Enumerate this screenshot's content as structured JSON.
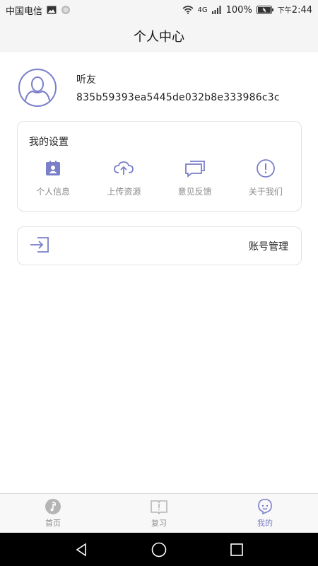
{
  "status_bar": {
    "carrier": "中国电信",
    "battery_percent": "100%",
    "time_prefix": "下午",
    "time": "2:44",
    "network": "4G"
  },
  "header": {
    "title": "个人中心"
  },
  "profile": {
    "name": "听友",
    "id": "835b59393ea5445de032b8e333986c3c"
  },
  "settings": {
    "title": "我的设置",
    "items": [
      {
        "label": "个人信息",
        "icon": "id-card-icon"
      },
      {
        "label": "上传资源",
        "icon": "cloud-upload-icon"
      },
      {
        "label": "意见反馈",
        "icon": "chat-bubbles-icon"
      },
      {
        "label": "关于我们",
        "icon": "info-circle-icon"
      }
    ]
  },
  "account": {
    "label": "账号管理",
    "icon": "login-icon"
  },
  "tabs": [
    {
      "label": "首页",
      "icon": "music-note-icon",
      "active": false
    },
    {
      "label": "复习",
      "icon": "book-icon",
      "active": false
    },
    {
      "label": "我的",
      "icon": "user-face-icon",
      "active": true
    }
  ],
  "colors": {
    "accent": "#7a7fc9",
    "icon_gray": "#b5b5b5"
  }
}
